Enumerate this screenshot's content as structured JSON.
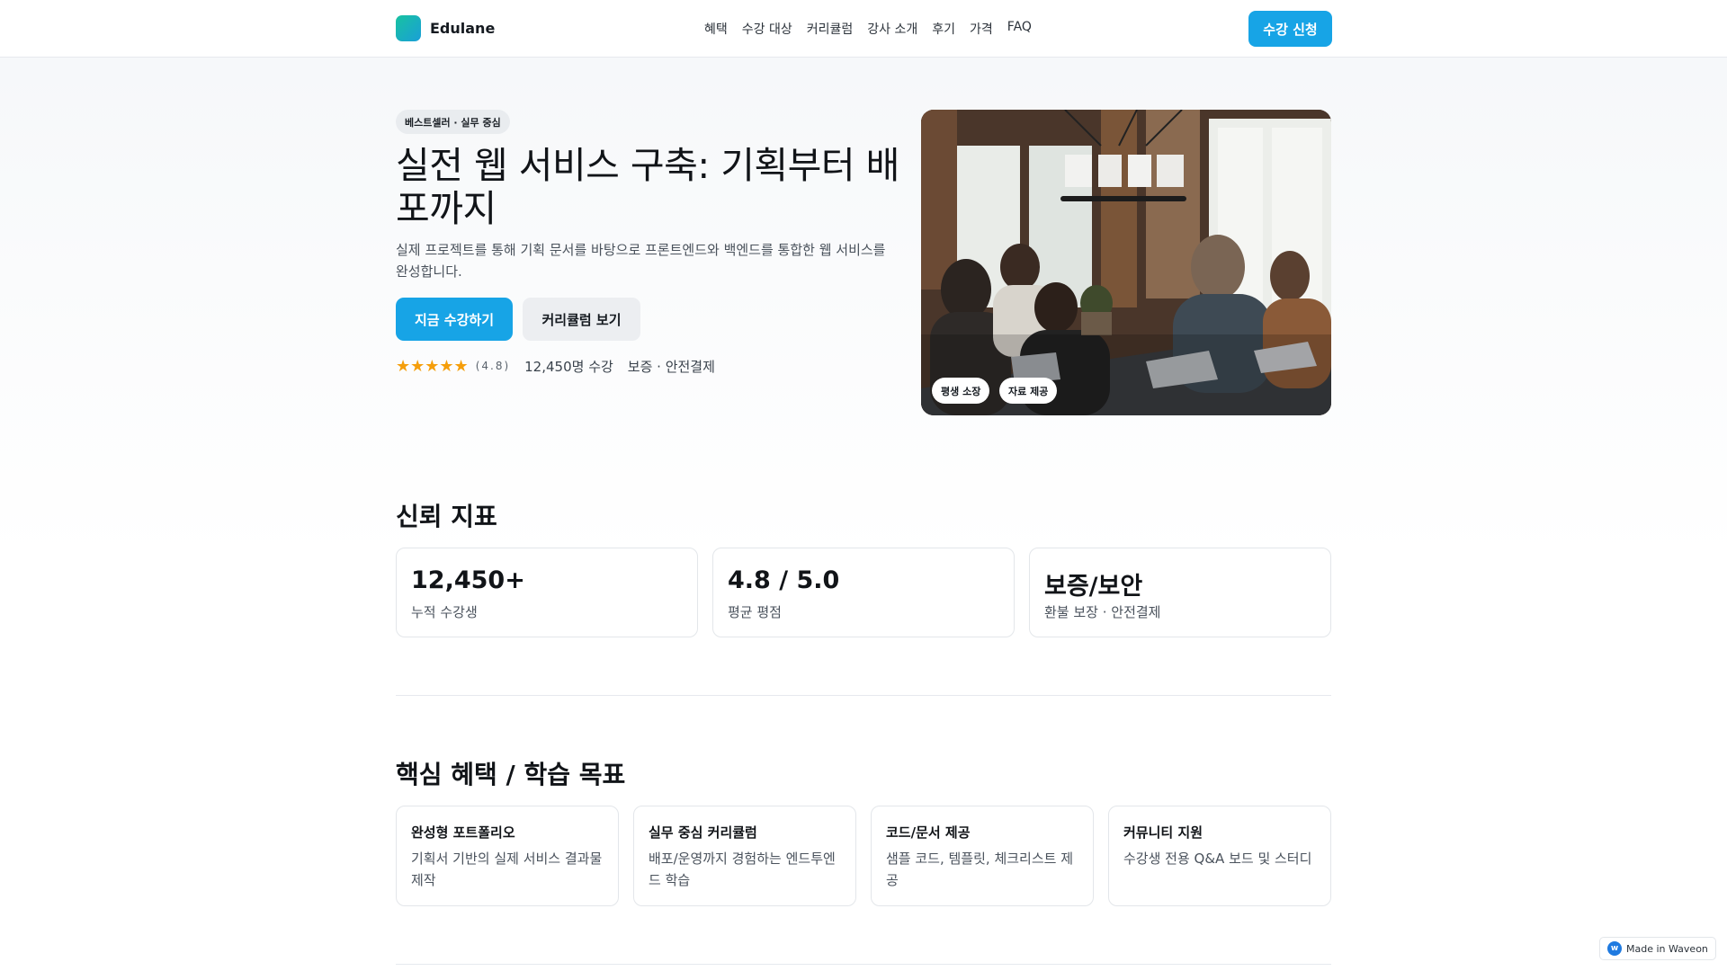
{
  "header": {
    "brand": "Edulane",
    "nav": [
      "혜택",
      "수강 대상",
      "커리큘럼",
      "강사 소개",
      "후기",
      "가격",
      "FAQ"
    ],
    "cta": "수강 신청"
  },
  "hero": {
    "badge": "베스트셀러 · 실무 중심",
    "title": "실전 웹 서비스 구축: 기획부터 배포까지",
    "subtitle": "실제 프로젝트를 통해 기획 문서를 바탕으로 프론트엔드와 백엔드를 통합한 웹 서비스를 완성합니다.",
    "primary_button": "지금 수강하기",
    "secondary_button": "커리큘럼 보기",
    "stars": "★★★★★",
    "rating": "(4.8)",
    "students": "12,450명 수강",
    "secure": "보증 · 안전결제",
    "image_chips": [
      "평생 소장",
      "자료 제공"
    ]
  },
  "trust": {
    "title": "신뢰 지표",
    "stats": [
      {
        "value": "12,450+",
        "label": "누적 수강생"
      },
      {
        "value": "4.8 / 5.0",
        "label": "평균 평점"
      },
      {
        "value": "보증/보안",
        "label": "환불 보장 · 안전결제"
      }
    ]
  },
  "benefits": {
    "title": "핵심 혜택 / 학습 목표",
    "items": [
      {
        "title": "완성형 포트폴리오",
        "desc": "기획서 기반의 실제 서비스 결과물 제작"
      },
      {
        "title": "실무 중심 커리큘럼",
        "desc": "배포/운영까지 경험하는 엔드투엔드 학습"
      },
      {
        "title": "코드/문서 제공",
        "desc": "샘플 코드, 템플릿, 체크리스트 제공"
      },
      {
        "title": "커뮤니티 지원",
        "desc": "수강생 전용 Q&A 보드 및 스터디"
      }
    ]
  },
  "footer_badge": {
    "icon": "w",
    "text": "Made in Waveon"
  },
  "colors": {
    "accent": "#17a4e6",
    "star": "#f59e0b",
    "brand_gradient_start": "#18c2a0",
    "brand_gradient_end": "#1a9fd8"
  }
}
